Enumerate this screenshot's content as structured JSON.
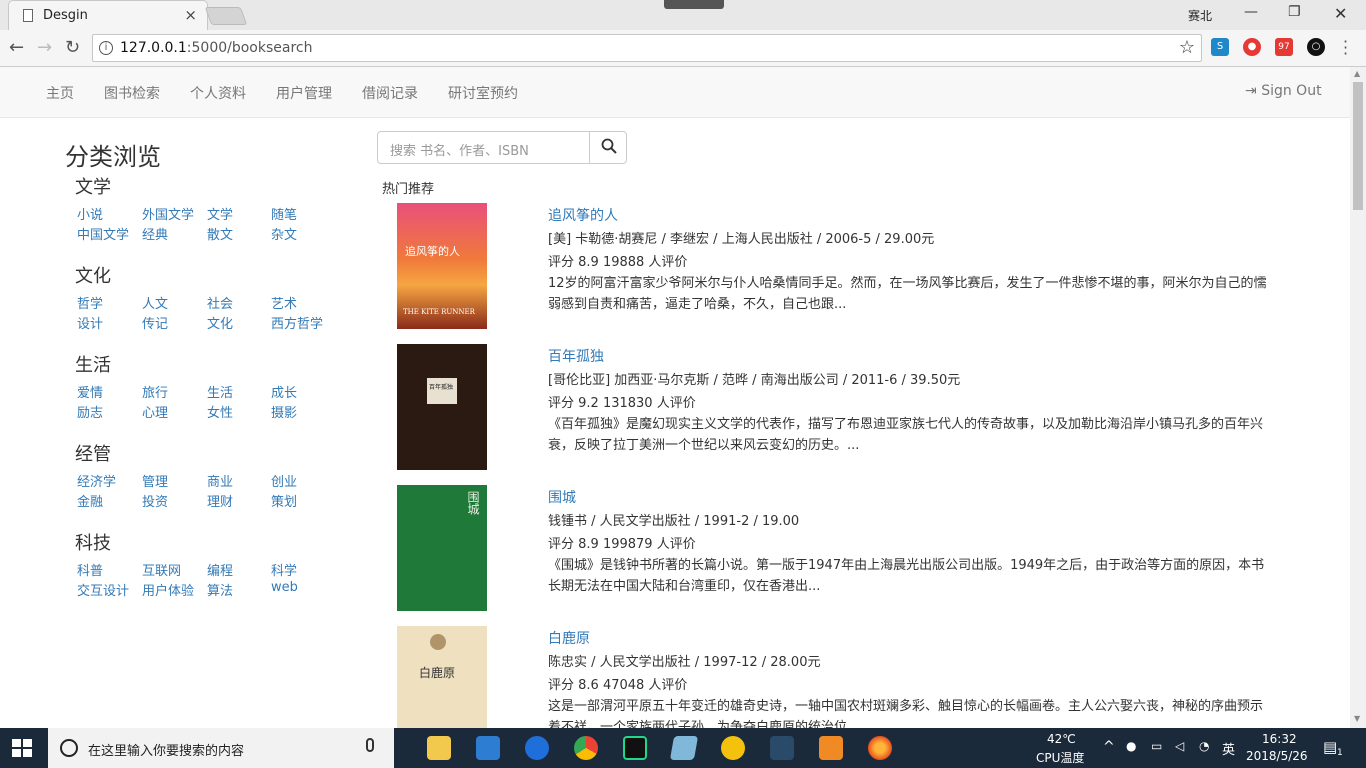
{
  "browser": {
    "tab_title": "Desgin",
    "tab_close": "×",
    "window_user": "赛北",
    "url_host": "127.0.0.1",
    "url_path": ":5000/booksearch",
    "ext_badge": "97"
  },
  "nav": {
    "items": [
      "主页",
      "图书检索",
      "个人资料",
      "用户管理",
      "借阅记录",
      "研讨室预约"
    ],
    "signout": "Sign Out"
  },
  "sidebar": {
    "title": "分类浏览",
    "categories": [
      {
        "name": "文学",
        "links": [
          "小说",
          "外国文学",
          "文学",
          "随笔",
          "中国文学",
          "经典",
          "散文",
          "杂文"
        ]
      },
      {
        "name": "文化",
        "links": [
          "哲学",
          "人文",
          "社会",
          "艺术",
          "设计",
          "传记",
          "文化",
          "西方哲学"
        ]
      },
      {
        "name": "生活",
        "links": [
          "爱情",
          "旅行",
          "生活",
          "成长",
          "励志",
          "心理",
          "女性",
          "摄影"
        ]
      },
      {
        "name": "经管",
        "links": [
          "经济学",
          "管理",
          "商业",
          "创业",
          "金融",
          "投资",
          "理财",
          "策划"
        ]
      },
      {
        "name": "科技",
        "links": [
          "科普",
          "互联网",
          "编程",
          "科学",
          "交互设计",
          "用户体验",
          "算法",
          "web"
        ]
      }
    ]
  },
  "search": {
    "placeholder": "搜索 书名、作者、ISBN"
  },
  "hot_label": "热门推荐",
  "books": [
    {
      "title": "追风筝的人",
      "meta": "[美] 卡勒德·胡赛尼 / 李继宏 / 上海人民出版社 / 2006-5 / 29.00元",
      "rating": "评分 8.9 19888 人评价",
      "desc": "12岁的阿富汗富家少爷阿米尔与仆人哈桑情同手足。然而，在一场风筝比赛后，发生了一件悲惨不堪的事，阿米尔为自己的懦弱感到自责和痛苦，逼走了哈桑，不久，自己也跟...",
      "cover_text": "追风筝的人",
      "cover_sub": "THE KITE RUNNER"
    },
    {
      "title": "百年孤独",
      "meta": "[哥伦比亚] 加西亚·马尔克斯 / 范晔 / 南海出版公司 / 2011-6 / 39.50元",
      "rating": "评分 9.2 131830 人评价",
      "desc": "《百年孤独》是魔幻现实主义文学的代表作，描写了布恩迪亚家族七代人的传奇故事，以及加勒比海沿岸小镇马孔多的百年兴衰，反映了拉丁美洲一个世纪以来风云变幻的历史。...",
      "cover_text": "百年孤独"
    },
    {
      "title": "围城",
      "meta": "钱锺书 / 人民文学出版社 / 1991-2 / 19.00",
      "rating": "评分 8.9 199879 人评价",
      "desc": "《围城》是钱钟书所著的长篇小说。第一版于1947年由上海晨光出版公司出版。1949年之后，由于政治等方面的原因，本书长期无法在中国大陆和台湾重印，仅在香港出...",
      "cover_text": "围城"
    },
    {
      "title": "白鹿原",
      "meta": "陈忠实 / 人民文学出版社 / 1997-12 / 28.00元",
      "rating": "评分 8.6 47048 人评价",
      "desc": "这是一部渭河平原五十年变迁的雄奇史诗，一轴中国农村斑斓多彩、触目惊心的长幅画卷。主人公六娶六丧，神秘的序曲预示着不祥。一个家族两代子孙，为争夺白鹿原的统治位...",
      "cover_text": "白鹿原"
    }
  ],
  "taskbar": {
    "search_placeholder": "在这里输入你要搜索的内容",
    "temp": "42℃",
    "temp_label": "CPU温度",
    "ime": "英",
    "time": "16:32",
    "date": "2018/5/26",
    "notif_count": "1"
  }
}
